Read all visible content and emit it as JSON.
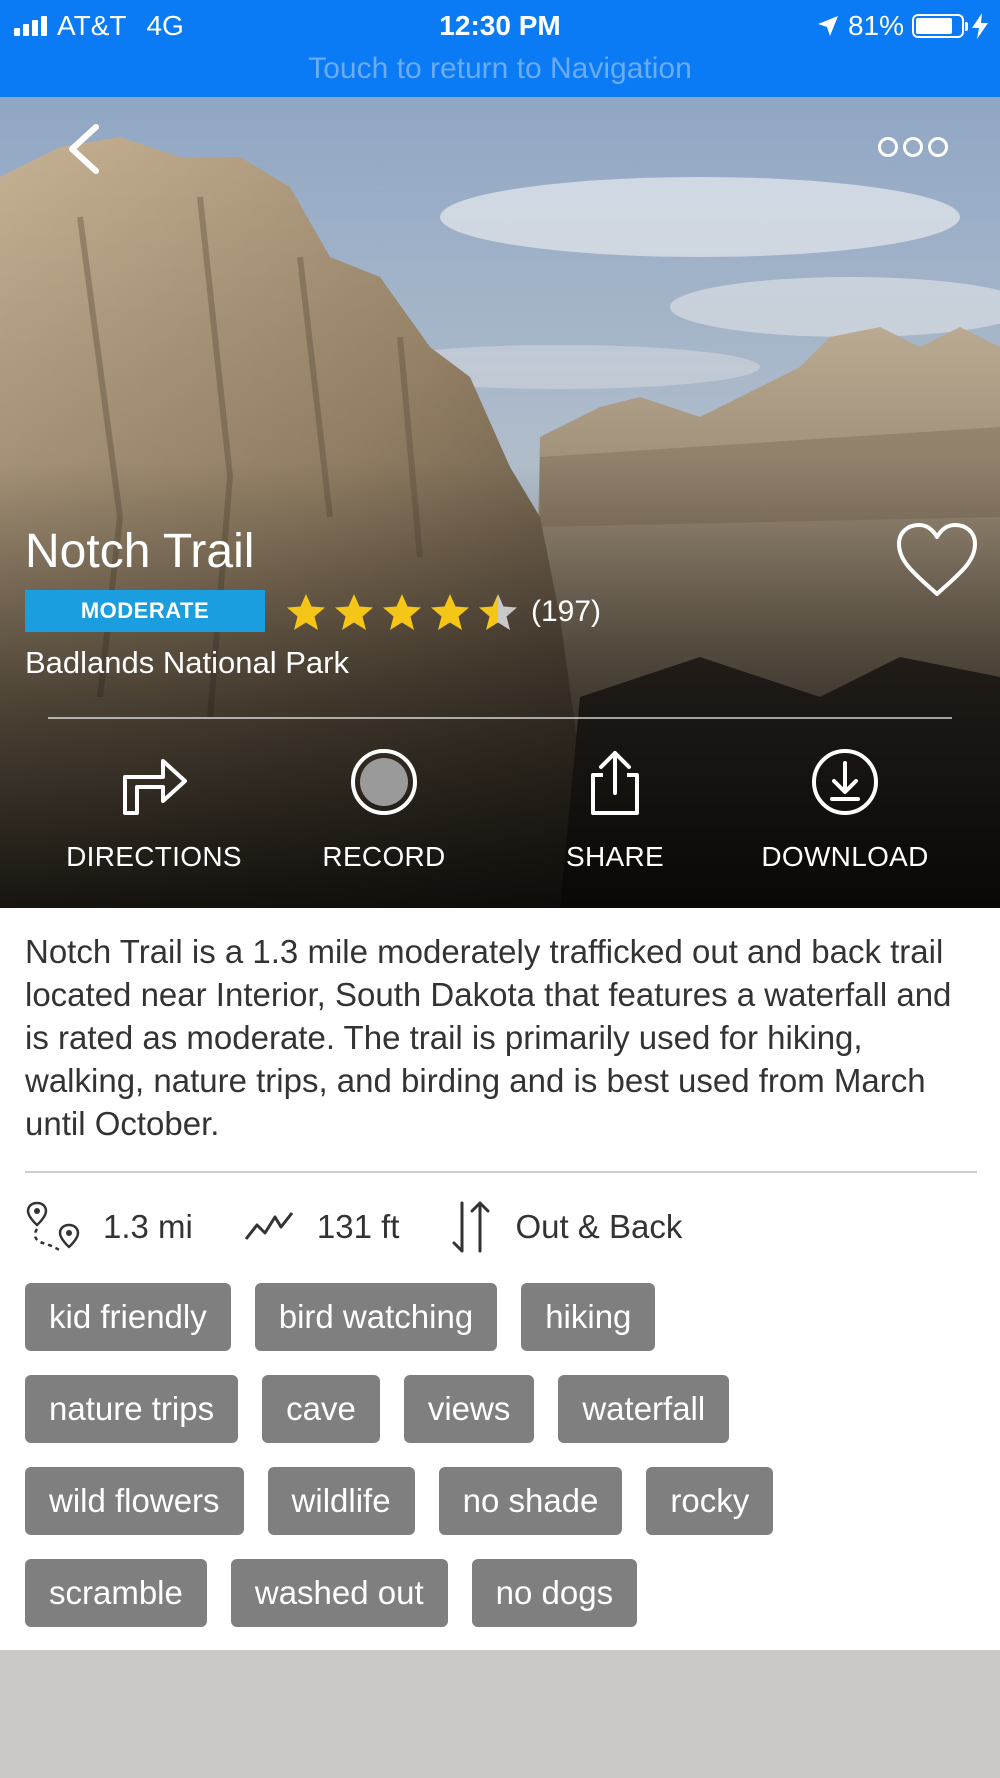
{
  "status_bar": {
    "carrier": "AT&T",
    "network": "4G",
    "time": "12:30 PM",
    "battery": "81%",
    "battery_level": 0.81,
    "return_text": "Touch to return to Navigation",
    "color": "#0a7af5"
  },
  "trail": {
    "name": "Notch Trail",
    "difficulty": "MODERATE",
    "difficulty_color": "#1a9ee0",
    "rating": 4.5,
    "rating_max": 5,
    "review_count": "(197)",
    "park": "Badlands National Park"
  },
  "actions": [
    {
      "label": "DIRECTIONS",
      "icon": "directions-icon"
    },
    {
      "label": "RECORD",
      "icon": "record-icon"
    },
    {
      "label": "SHARE",
      "icon": "share-icon"
    },
    {
      "label": "DOWNLOAD",
      "icon": "download-icon"
    }
  ],
  "description": "Notch Trail is a 1.3 mile moderately trafficked out and back trail located near Interior, South Dakota that features a waterfall and is rated as moderate. The trail is primarily used for hiking, walking, nature trips, and birding and is best used from March until October.",
  "stats": {
    "distance": "1.3 mi",
    "elevation": "131 ft",
    "route_type": "Out & Back"
  },
  "tags": [
    [
      "kid friendly",
      "bird watching",
      "hiking"
    ],
    [
      "nature trips",
      "cave",
      "views",
      "waterfall"
    ],
    [
      "wild flowers",
      "wildlife",
      "no shade",
      "rocky"
    ],
    [
      "scramble",
      "washed out",
      "no dogs"
    ]
  ]
}
